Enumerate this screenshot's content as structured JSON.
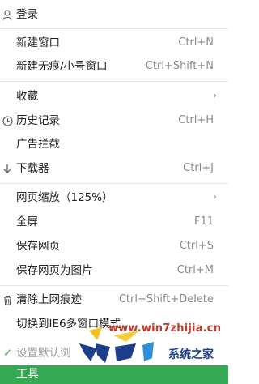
{
  "menu": {
    "login": {
      "icon": "user-icon",
      "label": "登录"
    },
    "new_window": {
      "label": "新建窗口",
      "shortcut": "Ctrl+N"
    },
    "new_private": {
      "label": "新建无痕/小号窗口",
      "shortcut": "Ctrl+Shift+N"
    },
    "favorites": {
      "label": "收藏"
    },
    "history": {
      "icon": "clock-icon",
      "label": "历史记录",
      "shortcut": "Ctrl+H"
    },
    "adblock": {
      "label": "广告拦截"
    },
    "downloads": {
      "icon": "download-arrow-icon",
      "label": "下载器",
      "shortcut": "Ctrl+J"
    },
    "zoom": {
      "label": "网页缩放（125%）"
    },
    "fullscreen": {
      "label": "全屏",
      "shortcut": "F11"
    },
    "save_page": {
      "label": "保存网页",
      "shortcut": "Ctrl+S"
    },
    "save_as_image": {
      "label": "保存网页为图片",
      "shortcut": "Ctrl+M"
    },
    "clear_traces": {
      "icon": "trash-icon",
      "label": "清除上网痕迹",
      "shortcut": "Ctrl+Shift+Delete"
    },
    "switch_ie6": {
      "label": "切换到IE6多窗口模式"
    },
    "set_default": {
      "icon": "checkmark-icon",
      "label": "设置默认浏"
    },
    "tools": {
      "label": "工具"
    }
  },
  "watermark": {
    "url": "www.win7zhijia.cn",
    "text": "系统之家"
  },
  "colors": {
    "accent": "#35a853",
    "shortcut_text": "#8a8a8a",
    "watermark_red": "#c0392b",
    "watermark_blue": "#1d3e8a"
  }
}
